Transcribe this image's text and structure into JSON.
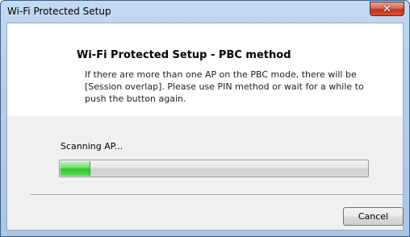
{
  "window": {
    "title": "Wi-Fi Protected Setup"
  },
  "content": {
    "heading": "Wi-Fi Protected Setup - PBC method",
    "description": "If there are more than one AP on the PBC mode, there will be [Session overlap]. Please use PIN method or wait for a while to push the button again.",
    "status_text": "Scanning AP...",
    "progress_percent": 10
  },
  "buttons": {
    "close_icon": "close-icon",
    "cancel_label": "Cancel"
  },
  "colors": {
    "progress_fill": "#3fcf3a",
    "title_bar": "#b6cfea",
    "close_button": "#c7412a"
  }
}
